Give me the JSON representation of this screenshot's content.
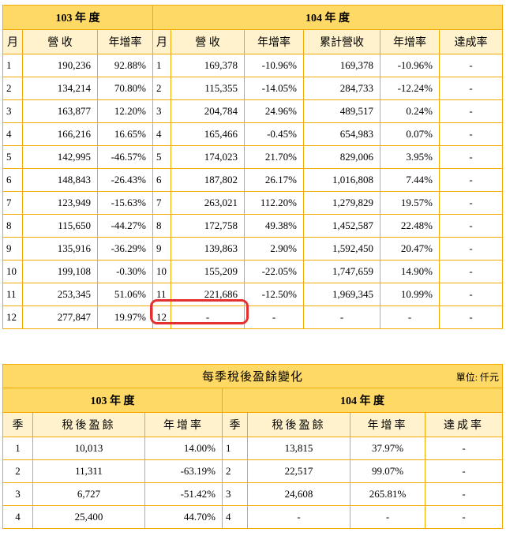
{
  "monthly": {
    "year103": "103 年 度",
    "year104": "104 年 度",
    "headers": {
      "month": "月",
      "revenue": "營 收",
      "yoy": "年增率",
      "cumulative": "累計營收",
      "achievement": "達成率"
    },
    "rows": [
      {
        "m103": "1",
        "rev103": "190,236",
        "yoy103": "92.88%",
        "m104": "1",
        "rev104": "169,378",
        "yoy104": "-10.96%",
        "cum": "169,378",
        "cumyoy": "-10.96%",
        "ach": "-"
      },
      {
        "m103": "2",
        "rev103": "134,214",
        "yoy103": "70.80%",
        "m104": "2",
        "rev104": "115,355",
        "yoy104": "-14.05%",
        "cum": "284,733",
        "cumyoy": "-12.24%",
        "ach": "-"
      },
      {
        "m103": "3",
        "rev103": "163,877",
        "yoy103": "12.20%",
        "m104": "3",
        "rev104": "204,784",
        "yoy104": "24.96%",
        "cum": "489,517",
        "cumyoy": "0.24%",
        "ach": "-"
      },
      {
        "m103": "4",
        "rev103": "166,216",
        "yoy103": "16.65%",
        "m104": "4",
        "rev104": "165,466",
        "yoy104": "-0.45%",
        "cum": "654,983",
        "cumyoy": "0.07%",
        "ach": "-"
      },
      {
        "m103": "5",
        "rev103": "142,995",
        "yoy103": "-46.57%",
        "m104": "5",
        "rev104": "174,023",
        "yoy104": "21.70%",
        "cum": "829,006",
        "cumyoy": "3.95%",
        "ach": "-"
      },
      {
        "m103": "6",
        "rev103": "148,843",
        "yoy103": "-26.43%",
        "m104": "6",
        "rev104": "187,802",
        "yoy104": "26.17%",
        "cum": "1,016,808",
        "cumyoy": "7.44%",
        "ach": "-"
      },
      {
        "m103": "7",
        "rev103": "123,949",
        "yoy103": "-15.63%",
        "m104": "7",
        "rev104": "263,021",
        "yoy104": "112.20%",
        "cum": "1,279,829",
        "cumyoy": "19.57%",
        "ach": "-"
      },
      {
        "m103": "8",
        "rev103": "115,650",
        "yoy103": "-44.27%",
        "m104": "8",
        "rev104": "172,758",
        "yoy104": "49.38%",
        "cum": "1,452,587",
        "cumyoy": "22.48%",
        "ach": "-"
      },
      {
        "m103": "9",
        "rev103": "135,916",
        "yoy103": "-36.29%",
        "m104": "9",
        "rev104": "139,863",
        "yoy104": "2.90%",
        "cum": "1,592,450",
        "cumyoy": "20.47%",
        "ach": "-"
      },
      {
        "m103": "10",
        "rev103": "199,108",
        "yoy103": "-0.30%",
        "m104": "10",
        "rev104": "155,209",
        "yoy104": "-22.05%",
        "cum": "1,747,659",
        "cumyoy": "14.90%",
        "ach": "-"
      },
      {
        "m103": "11",
        "rev103": "253,345",
        "yoy103": "51.06%",
        "m104": "11",
        "rev104": "221,686",
        "yoy104": "-12.50%",
        "cum": "1,969,345",
        "cumyoy": "10.99%",
        "ach": "-"
      },
      {
        "m103": "12",
        "rev103": "277,847",
        "yoy103": "19.97%",
        "m104": "12",
        "rev104": "-",
        "yoy104": "-",
        "cum": "-",
        "cumyoy": "-",
        "ach": "-"
      }
    ]
  },
  "quarterly": {
    "title": "每季稅後盈餘變化",
    "unit": "單位: 仟元",
    "year103": "103 年 度",
    "year104": "104 年 度",
    "headers": {
      "quarter": "季",
      "earnings": "稅後盈餘",
      "yoy": "年增率",
      "achievement": "達成率"
    },
    "rows": [
      {
        "q103": "1",
        "e103": "10,013",
        "yoy103": "14.00%",
        "q104": "1",
        "e104": "13,815",
        "yoy104": "37.97%",
        "ach": "-"
      },
      {
        "q103": "2",
        "e103": "11,311",
        "yoy103": "-63.19%",
        "q104": "2",
        "e104": "22,517",
        "yoy104": "99.07%",
        "ach": "-"
      },
      {
        "q103": "3",
        "e103": "6,727",
        "yoy103": "-51.42%",
        "q104": "3",
        "e104": "24,608",
        "yoy104": "265.81%",
        "ach": "-"
      },
      {
        "q103": "4",
        "e103": "25,400",
        "yoy103": "44.70%",
        "q104": "4",
        "e104": "-",
        "yoy104": "-",
        "ach": "-"
      }
    ]
  }
}
